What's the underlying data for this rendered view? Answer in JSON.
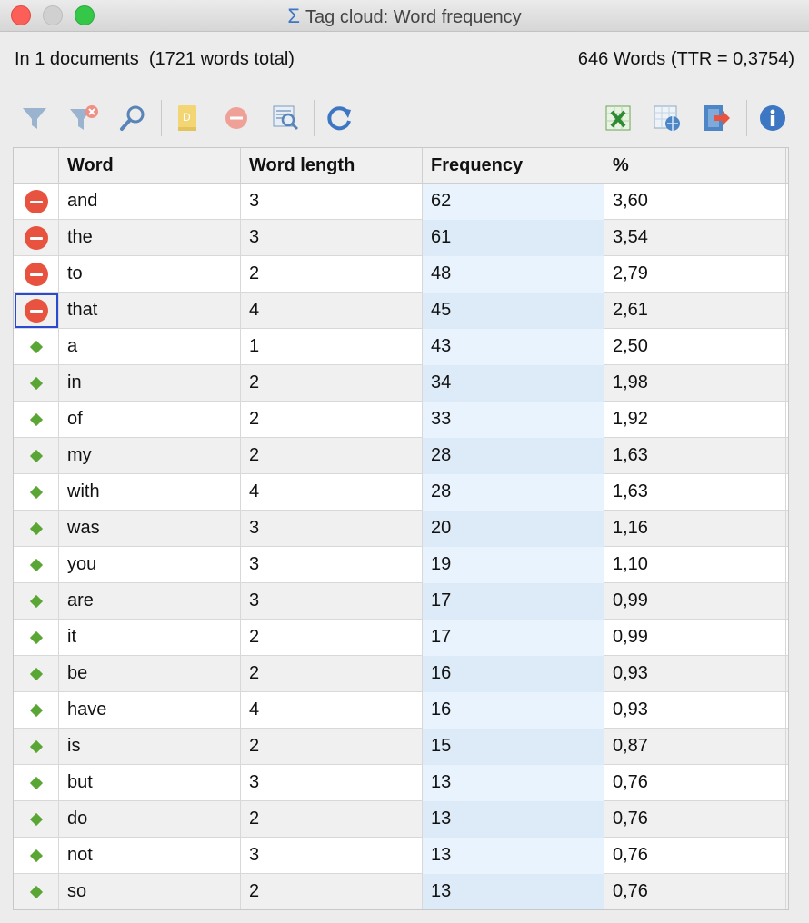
{
  "window": {
    "title": "Tag cloud: Word frequency",
    "icon": "sigma-icon"
  },
  "summary": {
    "left": "In 1 documents  (1721 words total)",
    "right": "646 Words (TTR = 0,3754)"
  },
  "toolbar": {
    "buttons": [
      {
        "name": "filter-icon"
      },
      {
        "name": "clear-filter-icon"
      },
      {
        "name": "search-icon"
      },
      {
        "name": "document-icon"
      },
      {
        "name": "stop-list-icon"
      },
      {
        "name": "find-in-document-icon"
      },
      {
        "name": "refresh-icon"
      },
      {
        "name": "excel-export-icon"
      },
      {
        "name": "web-export-icon"
      },
      {
        "name": "export-icon"
      },
      {
        "name": "info-icon"
      }
    ]
  },
  "table": {
    "headers": [
      "",
      "Word",
      "Word length",
      "Frequency",
      "%"
    ],
    "rows": [
      {
        "status": "stop",
        "word": "and",
        "length": "3",
        "freq": "62",
        "pct": "3,60"
      },
      {
        "status": "stop",
        "word": "the",
        "length": "3",
        "freq": "61",
        "pct": "3,54"
      },
      {
        "status": "stop",
        "word": "to",
        "length": "2",
        "freq": "48",
        "pct": "2,79"
      },
      {
        "status": "stop",
        "word": "that",
        "length": "4",
        "freq": "45",
        "pct": "2,61"
      },
      {
        "status": "go",
        "word": "a",
        "length": "1",
        "freq": "43",
        "pct": "2,50"
      },
      {
        "status": "go",
        "word": "in",
        "length": "2",
        "freq": "34",
        "pct": "1,98"
      },
      {
        "status": "go",
        "word": "of",
        "length": "2",
        "freq": "33",
        "pct": "1,92"
      },
      {
        "status": "go",
        "word": "my",
        "length": "2",
        "freq": "28",
        "pct": "1,63"
      },
      {
        "status": "go",
        "word": "with",
        "length": "4",
        "freq": "28",
        "pct": "1,63"
      },
      {
        "status": "go",
        "word": "was",
        "length": "3",
        "freq": "20",
        "pct": "1,16"
      },
      {
        "status": "go",
        "word": "you",
        "length": "3",
        "freq": "19",
        "pct": "1,10"
      },
      {
        "status": "go",
        "word": "are",
        "length": "3",
        "freq": "17",
        "pct": "0,99"
      },
      {
        "status": "go",
        "word": "it",
        "length": "2",
        "freq": "17",
        "pct": "0,99"
      },
      {
        "status": "go",
        "word": "be",
        "length": "2",
        "freq": "16",
        "pct": "0,93"
      },
      {
        "status": "go",
        "word": "have",
        "length": "4",
        "freq": "16",
        "pct": "0,93"
      },
      {
        "status": "go",
        "word": "is",
        "length": "2",
        "freq": "15",
        "pct": "0,87"
      },
      {
        "status": "go",
        "word": "but",
        "length": "3",
        "freq": "13",
        "pct": "0,76"
      },
      {
        "status": "go",
        "word": "do",
        "length": "2",
        "freq": "13",
        "pct": "0,76"
      },
      {
        "status": "go",
        "word": "not",
        "length": "3",
        "freq": "13",
        "pct": "0,76"
      },
      {
        "status": "go",
        "word": "so",
        "length": "2",
        "freq": "13",
        "pct": "0,76"
      }
    ],
    "focused_row": 3
  },
  "colors": {
    "stop": "#e8533f",
    "go": "#5aa634",
    "frequency_column": "#e9f3fd",
    "accent": "#3d76c2"
  }
}
